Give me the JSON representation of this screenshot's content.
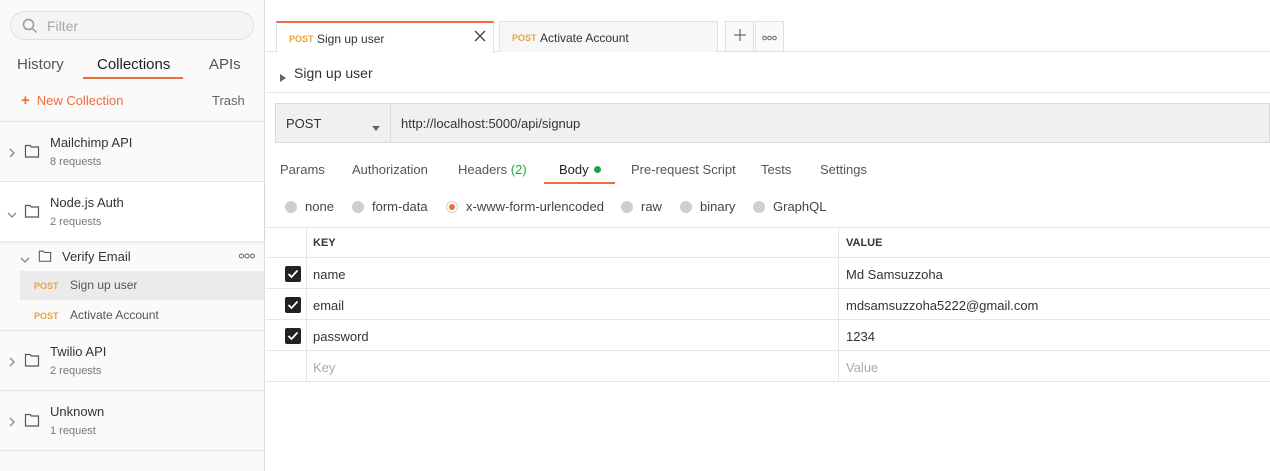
{
  "sidebar": {
    "filter_placeholder": "Filter",
    "tabs": [
      "History",
      "Collections",
      "APIs"
    ],
    "new_collection": "New Collection",
    "trash": "Trash",
    "collections": [
      {
        "name": "Mailchimp API",
        "count": "8 requests"
      },
      {
        "name": "Node.js Auth",
        "count": "2 requests"
      },
      {
        "name": "Twilio API",
        "count": "2 requests"
      },
      {
        "name": "Unknown",
        "count": "1 request"
      }
    ],
    "folder": {
      "name": "Verify Email"
    },
    "requests": [
      {
        "method": "POST",
        "name": "Sign up user"
      },
      {
        "method": "POST",
        "name": "Activate Account"
      }
    ]
  },
  "tabs": [
    {
      "method": "POST",
      "name": "Sign up user"
    },
    {
      "method": "POST",
      "name": "Activate Account"
    }
  ],
  "request": {
    "title": "Sign up user",
    "method": "POST",
    "url": "http://localhost:5000/api/signup"
  },
  "subtabs": {
    "params": "Params",
    "authorization": "Authorization",
    "headers": "Headers",
    "headers_count": "(2)",
    "body": "Body",
    "prerequest": "Pre-request Script",
    "tests": "Tests",
    "settings": "Settings"
  },
  "body_types": [
    "none",
    "form-data",
    "x-www-form-urlencoded",
    "raw",
    "binary",
    "GraphQL"
  ],
  "table": {
    "headers": {
      "key": "KEY",
      "value": "VALUE"
    },
    "rows": [
      {
        "key": "name",
        "value": "Md Samsuzzoha"
      },
      {
        "key": "email",
        "value": "mdsamsuzzoha5222@gmail.com"
      },
      {
        "key": "password",
        "value": "1234"
      }
    ],
    "placeholder": {
      "key": "Key",
      "value": "Value"
    }
  },
  "colors": {
    "accent": "#f26b3a",
    "post": "#e8a534",
    "green": "#2c9f4a"
  }
}
